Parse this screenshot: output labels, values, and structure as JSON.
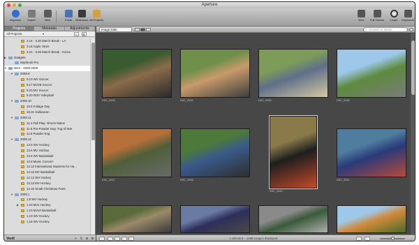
{
  "window": {
    "title": "Aperture"
  },
  "toolbar": {
    "left": [
      {
        "label": "Inspector",
        "icon": "info-icon"
      },
      {
        "label": "Import",
        "icon": "import-icon"
      },
      {
        "label": "New",
        "icon": "new-project-icon"
      },
      {
        "label": "Email",
        "icon": "email-icon"
      },
      {
        "label": "Slideshow",
        "icon": "slideshow-icon"
      },
      {
        "label": "All Projects",
        "icon": "all-projects-icon"
      }
    ],
    "right": [
      {
        "label": "View",
        "icon": "view-icon"
      },
      {
        "label": "Full Screen",
        "icon": "full-screen-icon"
      },
      {
        "label": "Loupe",
        "icon": "loupe-icon"
      },
      {
        "label": "Keywords",
        "icon": "keywords-icon"
      }
    ]
  },
  "sidebar": {
    "tabs": [
      {
        "label": "Projects"
      },
      {
        "label": "Metadata"
      },
      {
        "label": "Adjustments"
      }
    ],
    "filter": "All Projects",
    "filter_add": "+.",
    "filter_action": "⚙.",
    "tree": [
      {
        "label": "3.14 - 3.20 March Break - LA",
        "level": 2,
        "kind": "project"
      },
      {
        "label": "3.16 Apple Store",
        "level": 2,
        "kind": "project"
      },
      {
        "label": "3.21 - 3.28 March Break - Korea",
        "level": 2,
        "kind": "project"
      },
      {
        "label": "Gadgets",
        "level": 0,
        "kind": "folder",
        "tri": "▶"
      },
      {
        "label": "MacBook Pro",
        "level": 1,
        "kind": "folder"
      },
      {
        "label": "NHS - 2008-2009",
        "level": 0,
        "kind": "folder",
        "tri": "▼",
        "selected": true
      },
      {
        "label": "2008.9",
        "level": 1,
        "kind": "folder",
        "tri": "▼"
      },
      {
        "label": "9.13 WV Soccer",
        "level": 2,
        "kind": "project"
      },
      {
        "label": "9.17 MJVB Soccer",
        "level": 2,
        "kind": "project"
      },
      {
        "label": "9.20 MV Soccer",
        "level": 2,
        "kind": "project"
      },
      {
        "label": "9.20 WJV Volleyball",
        "level": 2,
        "kind": "project"
      },
      {
        "label": "2008.10",
        "level": 1,
        "kind": "folder",
        "tri": "▼"
      },
      {
        "label": "10.6 Foliage Day",
        "level": 2,
        "kind": "project"
      },
      {
        "label": "10.31 Halloween",
        "level": 2,
        "kind": "project"
      },
      {
        "label": "2008.11",
        "level": 1,
        "kind": "folder",
        "tri": "▼"
      },
      {
        "label": "11.4 Fall Play: Almost Maine",
        "level": 2,
        "kind": "project"
      },
      {
        "label": "11.6 Pre-Powder Keg: Tug of War",
        "level": 2,
        "kind": "project"
      },
      {
        "label": "11.8 Powder Keg",
        "level": 2,
        "kind": "project"
      },
      {
        "label": "2008.12",
        "level": 1,
        "kind": "folder",
        "tri": "▼"
      },
      {
        "label": "12.5 WV Hockey",
        "level": 2,
        "kind": "project"
      },
      {
        "label": "12.6 MV Hockey",
        "level": 2,
        "kind": "project"
      },
      {
        "label": "12.6 WV Basketball",
        "level": 2,
        "kind": "project"
      },
      {
        "label": "12.8 Music Concert",
        "level": 2,
        "kind": "project"
      },
      {
        "label": "12.12 International Students for Ha...",
        "level": 2,
        "kind": "project"
      },
      {
        "label": "12.10 MV Basketball",
        "level": 2,
        "kind": "project"
      },
      {
        "label": "12.12 WV Hockey",
        "level": 2,
        "kind": "project"
      },
      {
        "label": "12.13 MV Hockey",
        "level": 2,
        "kind": "project"
      },
      {
        "label": "12.16 Small Christmas Parts",
        "level": 2,
        "kind": "project"
      },
      {
        "label": "2009.1",
        "level": 1,
        "kind": "folder",
        "tri": "▼"
      },
      {
        "label": "1.9 WV Hockey",
        "level": 2,
        "kind": "project"
      },
      {
        "label": "1.10 MJV Hockey",
        "level": 2,
        "kind": "project",
        "tri": "▶"
      },
      {
        "label": "1.10 MJVA Basketball",
        "level": 2,
        "kind": "project"
      },
      {
        "label": "1.10 WV Hockey",
        "level": 2,
        "kind": "project"
      },
      {
        "label": "1.16 WV Hockey",
        "level": 2,
        "kind": "project"
      }
    ],
    "footer": {
      "label": "Vault",
      "btn_add": "+",
      "btn_sync": "↻",
      "btn_delete": "⊘",
      "btn_action": "⚙"
    }
  },
  "browser": {
    "sort": "Image Date",
    "search_placeholder": "Unrated or Better",
    "status": "1 selected – 1188 images displayed",
    "photos": [
      {
        "caption": "DSC_2933",
        "colors": [
          "#3a5a30",
          "#8a6b4a",
          "#2b2b2b"
        ]
      },
      {
        "caption": "DSC_2934",
        "colors": [
          "#6f8f4a",
          "#c89a6a",
          "#3d3d3d"
        ]
      },
      {
        "caption": "DSC_2935",
        "colors": [
          "#7d9c5a",
          "#5f6f8a",
          "#d6c8a2"
        ]
      },
      {
        "caption": "DSC_2936",
        "colors": [
          "#9ec8ea",
          "#5e8a3e",
          "#7b7b7b"
        ]
      },
      {
        "caption": "DSC_2937",
        "colors": [
          "#b8703a",
          "#4f5f3a",
          "#6a6a6a"
        ]
      },
      {
        "caption": "DSC_2938",
        "colors": [
          "#4d7a3a",
          "#3a5a8a",
          "#2e2e2e"
        ]
      },
      {
        "caption": "DSC_2940",
        "colors": [
          "#8a7a4a",
          "#1e1e1e",
          "#c44a2a"
        ]
      },
      {
        "caption": "DSC_2941",
        "colors": [
          "#4e7d9e",
          "#2a3a7a",
          "#b84a3a"
        ]
      },
      {
        "caption": "",
        "colors": [
          "#5a6a3a",
          "#9a8a6a",
          "#3a3a3a"
        ]
      },
      {
        "caption": "",
        "colors": [
          "#6a7aa0",
          "#2e2e5a",
          "#4a4a4a"
        ]
      },
      {
        "caption": "",
        "colors": [
          "#8a8a8a",
          "#3a5a3a",
          "#b0b0b0"
        ]
      },
      {
        "caption": "",
        "colors": [
          "#9ec8ea",
          "#d08a3a",
          "#4a6a2a"
        ]
      }
    ]
  }
}
